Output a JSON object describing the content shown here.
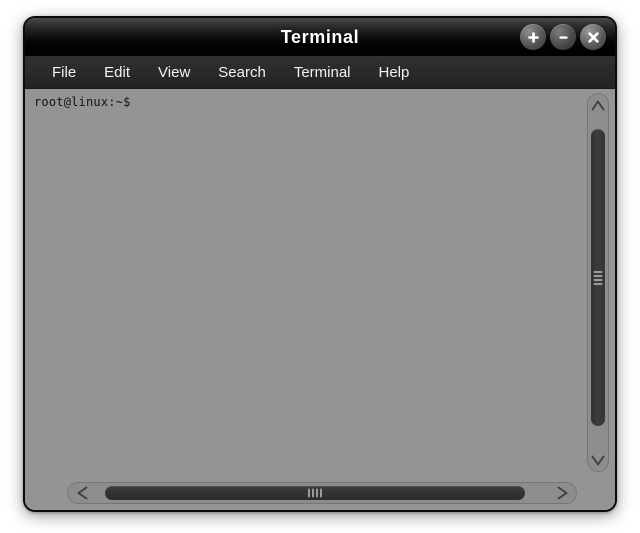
{
  "window": {
    "title": "Terminal",
    "controls": [
      {
        "name": "maximize-button",
        "icon": "plus-icon",
        "label": "+"
      },
      {
        "name": "minimize-button",
        "icon": "minus-icon",
        "label": "−"
      },
      {
        "name": "close-button",
        "icon": "close-icon",
        "label": "✕"
      }
    ]
  },
  "menubar": {
    "items": [
      {
        "label": "File"
      },
      {
        "label": "Edit"
      },
      {
        "label": "View"
      },
      {
        "label": "Search"
      },
      {
        "label": "Terminal"
      },
      {
        "label": "Help"
      }
    ]
  },
  "terminal": {
    "prompt": "root@linux:~$",
    "lines": [
      "root@linux:~$"
    ]
  },
  "scrollbars": {
    "vertical": {
      "up_arrow_icon": "chevron-up-icon",
      "down_arrow_icon": "chevron-down-icon",
      "grip_lines": 4
    },
    "horizontal": {
      "left_arrow_icon": "chevron-left-icon",
      "right_arrow_icon": "chevron-right-icon",
      "grip_lines": 4
    }
  },
  "colors": {
    "window_background": "#949494",
    "titlebar_top": "#4a4a4a",
    "titlebar_bottom": "#000000",
    "menubar": "#2a2a2a",
    "menu_text": "#f2f2f2",
    "terminal_text": "#141414",
    "scroll_trough": "#8d8d8d",
    "scroll_thumb": "#343434",
    "window_border": "#0b0b0b"
  }
}
